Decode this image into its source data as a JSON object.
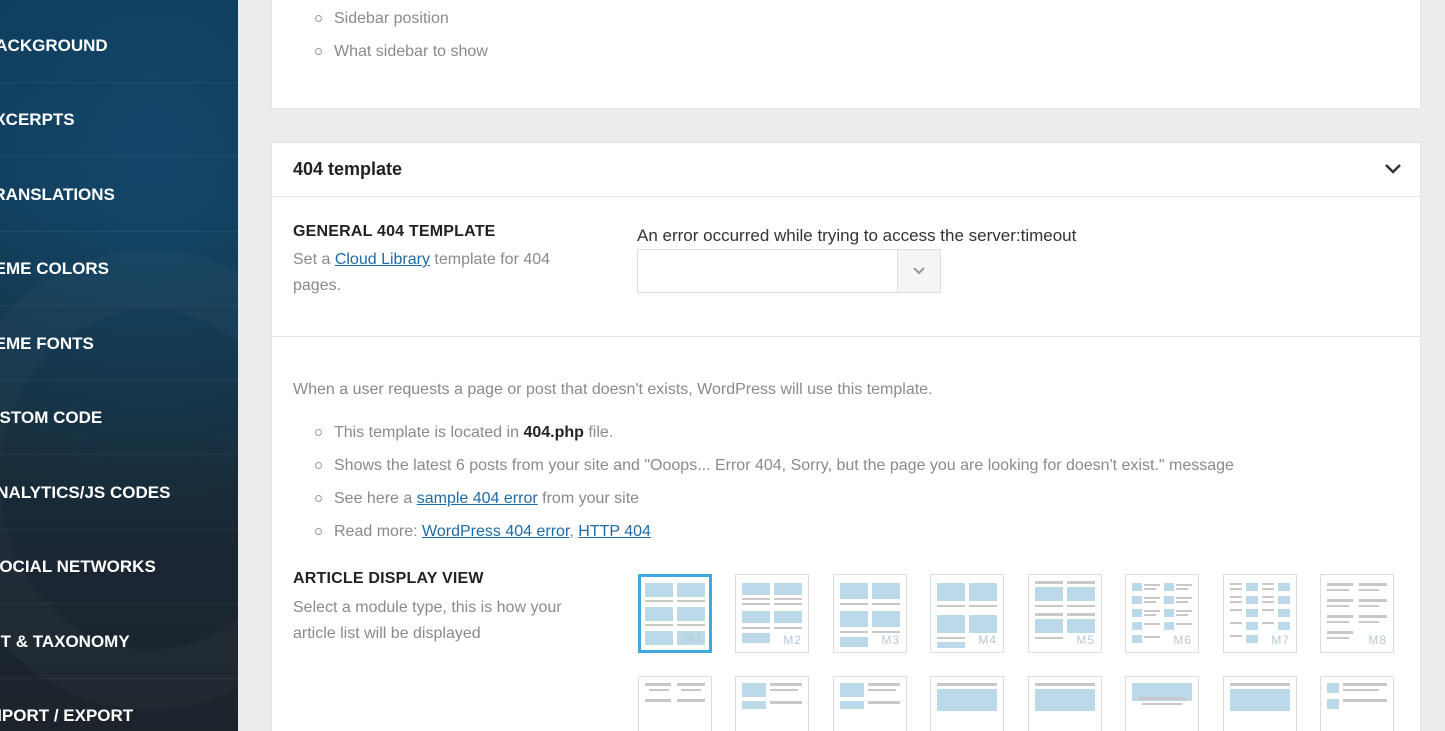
{
  "sidebar": {
    "items": [
      {
        "label": "BACKGROUND"
      },
      {
        "label": "EXCERPTS"
      },
      {
        "label": "TRANSLATIONS"
      },
      {
        "label": "THEME COLORS"
      },
      {
        "label": "THEME FONTS"
      },
      {
        "label": "CUSTOM CODE"
      },
      {
        "label": "ANALYTICS/JS CODES"
      },
      {
        "label": "SOCIAL NETWORKS"
      },
      {
        "label": "CPT & TAXONOMY"
      },
      {
        "label": "IMPORT / EXPORT"
      }
    ]
  },
  "top_panel": {
    "bullets": [
      "Sidebar position",
      "What sidebar to show"
    ]
  },
  "panel_404": {
    "title": "404 template",
    "general": {
      "title": "GENERAL 404 TEMPLATE",
      "desc_prefix": "Set a",
      "desc_link": "Cloud Library",
      "desc_suffix": "template for 404",
      "desc_line2": "pages.",
      "error_message": "An error occurred while trying to access the server:timeout",
      "select_value": ""
    },
    "intro": "When a user requests a page or post that doesn't exists, WordPress will use this template.",
    "bullets": {
      "b1_prefix": "This template is located in",
      "b1_bold": "404.php",
      "b1_suffix": "file.",
      "b2": "Shows the latest 6 posts from your site and \"Ooops... Error 404, Sorry, but the page you are looking for doesn't exist.\" message",
      "b3_prefix": "See here a",
      "b3_link": "sample 404 error",
      "b3_suffix": "from your site",
      "b4_prefix": "Read more:",
      "b4_link1": "WordPress 404 error",
      "b4_sep": ",",
      "b4_link2": "HTTP 404"
    },
    "article_view": {
      "title": "ARTICLE DISPLAY VIEW",
      "desc_line1": "Select a module type, this is how your",
      "desc_line2": "article list will be displayed",
      "modules": [
        {
          "label": "M1",
          "selected": true
        },
        {
          "label": "M2",
          "selected": false
        },
        {
          "label": "M3",
          "selected": false
        },
        {
          "label": "M4",
          "selected": false
        },
        {
          "label": "M5",
          "selected": false
        },
        {
          "label": "M6",
          "selected": false
        },
        {
          "label": "M7",
          "selected": false
        },
        {
          "label": "M8",
          "selected": false
        }
      ]
    }
  },
  "colors": {
    "accent": "#3da9e0",
    "link": "#1e6aa8",
    "thumb_blue": "#bcd9ea",
    "thumb_gray": "#c8c8c8"
  }
}
